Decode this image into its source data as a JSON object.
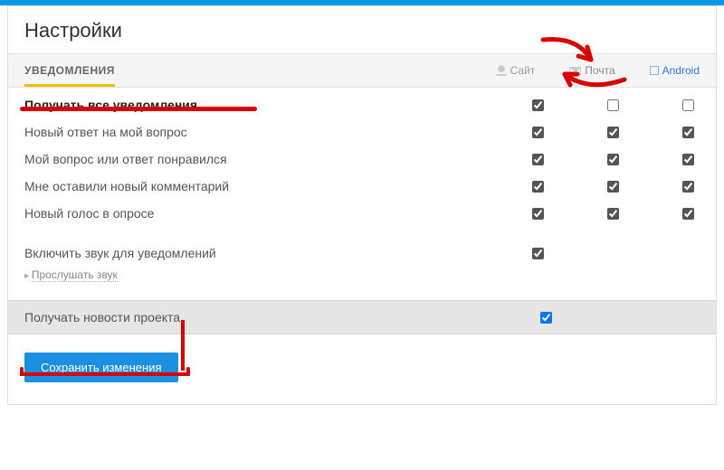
{
  "page": {
    "title": "Настройки"
  },
  "tabs": {
    "active": "УВЕДОМЛЕНИЯ"
  },
  "columns": {
    "site": "Сайт",
    "mail": "Почта",
    "android": "Android"
  },
  "rows": [
    {
      "label": "Получать все уведомления",
      "bold": true,
      "c": [
        true,
        false,
        false
      ]
    },
    {
      "label": "Новый ответ на мой вопрос",
      "bold": false,
      "c": [
        true,
        true,
        true
      ]
    },
    {
      "label": "Мой вопрос или ответ понравился",
      "bold": false,
      "c": [
        true,
        true,
        true
      ]
    },
    {
      "label": "Мне оставили новый комментарий",
      "bold": false,
      "c": [
        true,
        true,
        true
      ]
    },
    {
      "label": "Новый голос в опросе",
      "bold": false,
      "c": [
        true,
        true,
        true
      ]
    }
  ],
  "sound": {
    "enable_label": "Включить звук для уведомлений",
    "enabled": true,
    "play_link": "Прослушать звук"
  },
  "news": {
    "label": "Получать новости проекта",
    "checked": true
  },
  "buttons": {
    "save": "Сохранить изменения"
  }
}
